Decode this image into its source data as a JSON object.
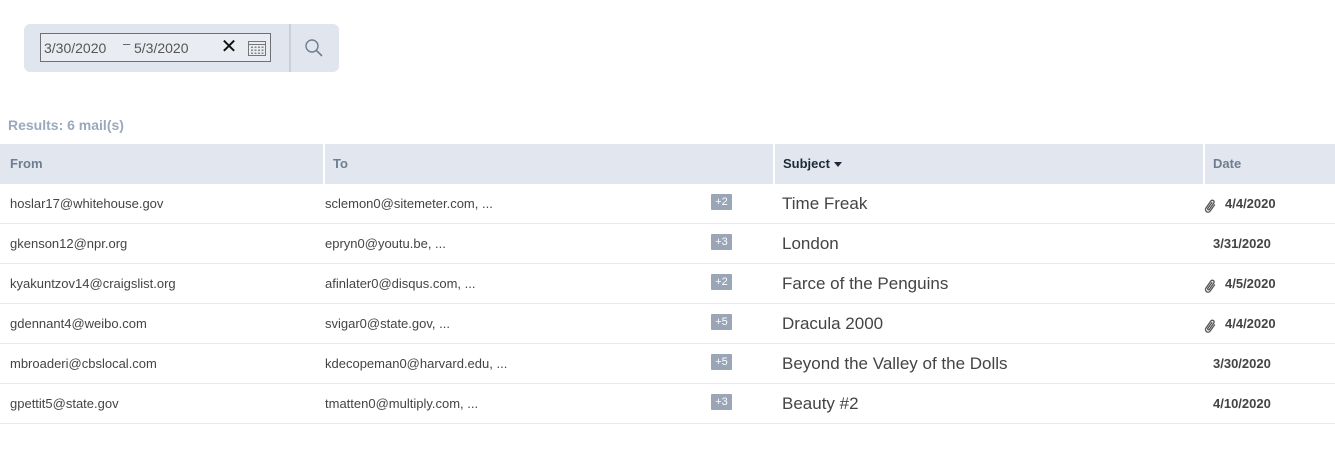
{
  "filter": {
    "date_from": "3/30/2020",
    "date_separator": "–",
    "date_to": "5/3/2020",
    "clear_label": "✕"
  },
  "results_label": "Results: 6 mail(s)",
  "columns": {
    "from": "From",
    "to": "To",
    "subject": "Subject",
    "date": "Date"
  },
  "sort_column": "Subject",
  "rows": [
    {
      "from": "hoslar17@whitehouse.gov",
      "to": "sclemon0@sitemeter.com, ...",
      "extra": "+2",
      "subject": "Time Freak",
      "attachment": true,
      "date": "4/4/2020"
    },
    {
      "from": "gkenson12@npr.org",
      "to": "epryn0@youtu.be, ...",
      "extra": "+3",
      "subject": "London",
      "attachment": false,
      "date": "3/31/2020"
    },
    {
      "from": "kyakuntzov14@craigslist.org",
      "to": "afinlater0@disqus.com, ...",
      "extra": "+2",
      "subject": "Farce of the Penguins",
      "attachment": true,
      "date": "4/5/2020"
    },
    {
      "from": "gdennant4@weibo.com",
      "to": "svigar0@state.gov, ...",
      "extra": "+5",
      "subject": "Dracula 2000",
      "attachment": true,
      "date": "4/4/2020"
    },
    {
      "from": "mbroaderi@cbslocal.com",
      "to": "kdecopeman0@harvard.edu, ...",
      "extra": "+5",
      "subject": "Beyond the Valley of the Dolls",
      "attachment": false,
      "date": "3/30/2020"
    },
    {
      "from": "gpettit5@state.gov",
      "to": "tmatten0@multiply.com, ...",
      "extra": "+3",
      "subject": "Beauty #2",
      "attachment": false,
      "date": "4/10/2020"
    }
  ],
  "icons": {
    "calendar": "calendar-icon",
    "search": "search-icon",
    "attachment": "paperclip-icon",
    "sort": "sort-desc-icon"
  }
}
